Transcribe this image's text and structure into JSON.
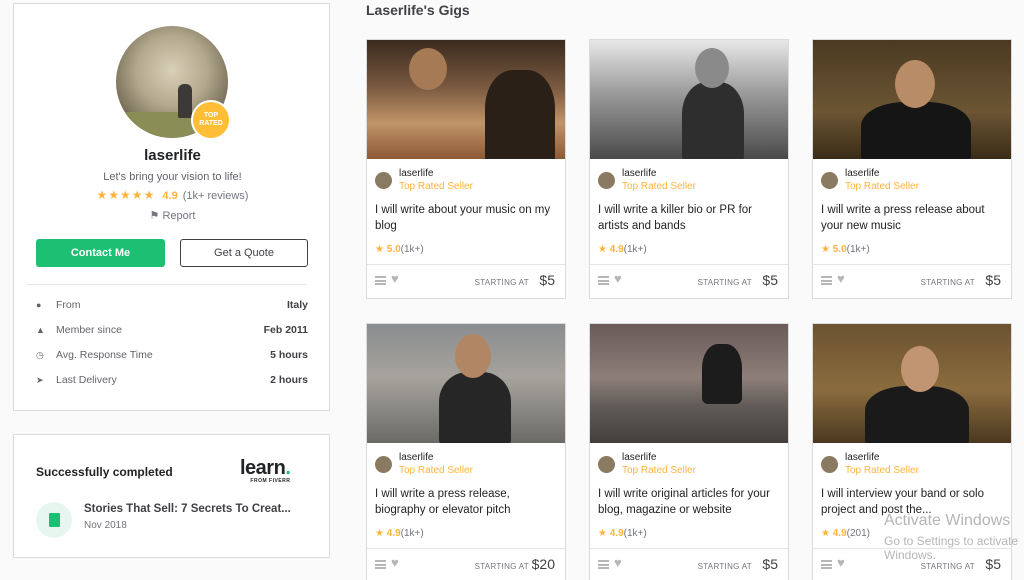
{
  "profile": {
    "badge_line1": "TOP",
    "badge_line2": "RATED",
    "username": "laserlife",
    "tagline": "Let's bring your vision to life!",
    "stars": "★★★★★",
    "rating": "4.9",
    "reviews": "(1k+ reviews)",
    "report": "Report",
    "contact_label": "Contact Me",
    "quote_label": "Get a Quote",
    "stats": [
      {
        "icon": "location-pin-icon",
        "label": "From",
        "value": "Italy"
      },
      {
        "icon": "user-icon",
        "label": "Member since",
        "value": "Feb 2011"
      },
      {
        "icon": "clock-icon",
        "label": "Avg. Response Time",
        "value": "5 hours"
      },
      {
        "icon": "paper-plane-icon",
        "label": "Last Delivery",
        "value": "2 hours"
      }
    ]
  },
  "learn": {
    "heading": "Successfully completed",
    "logo_text": "learn",
    "logo_dot": ".",
    "logo_sub": "FROM FIVERR",
    "course_title": "Stories That Sell: 7 Secrets To Creat...",
    "course_date": "Nov 2018"
  },
  "gigs_title": "Laserlife's Gigs",
  "gigs": [
    {
      "seller": "laserlife",
      "level": "Top Rated Seller",
      "title": "I will write about your music on my blog",
      "rating": "5.0",
      "count": "(1k+)",
      "starting": "STARTING AT",
      "price": "$5"
    },
    {
      "seller": "laserlife",
      "level": "Top Rated Seller",
      "title": "I will write a killer bio or PR for artists and bands",
      "rating": "4.9",
      "count": "(1k+)",
      "starting": "STARTING AT",
      "price": "$5"
    },
    {
      "seller": "laserlife",
      "level": "Top Rated Seller",
      "title": "I will write a press release about your new music",
      "rating": "5.0",
      "count": "(1k+)",
      "starting": "STARTING AT",
      "price": "$5"
    },
    {
      "seller": "laserlife",
      "level": "Top Rated Seller",
      "title": "I will write a press release, biography or elevator pitch",
      "rating": "4.9",
      "count": "(1k+)",
      "starting": "STARTING AT",
      "price": "$20"
    },
    {
      "seller": "laserlife",
      "level": "Top Rated Seller",
      "title": "I will write original articles for your blog, magazine or website",
      "rating": "4.9",
      "count": "(1k+)",
      "starting": "STARTING AT",
      "price": "$5"
    },
    {
      "seller": "laserlife",
      "level": "Top Rated Seller",
      "title": "I will interview your band or solo project and post the...",
      "rating": "4.9",
      "count": "(201)",
      "starting": "STARTING AT",
      "price": "$5"
    }
  ],
  "watermark": {
    "line1": "Activate Windows",
    "line2": "Go to Settings to activate Windows."
  },
  "colors": {
    "accent_green": "#1dbf73",
    "star_yellow": "#ffb33e"
  }
}
